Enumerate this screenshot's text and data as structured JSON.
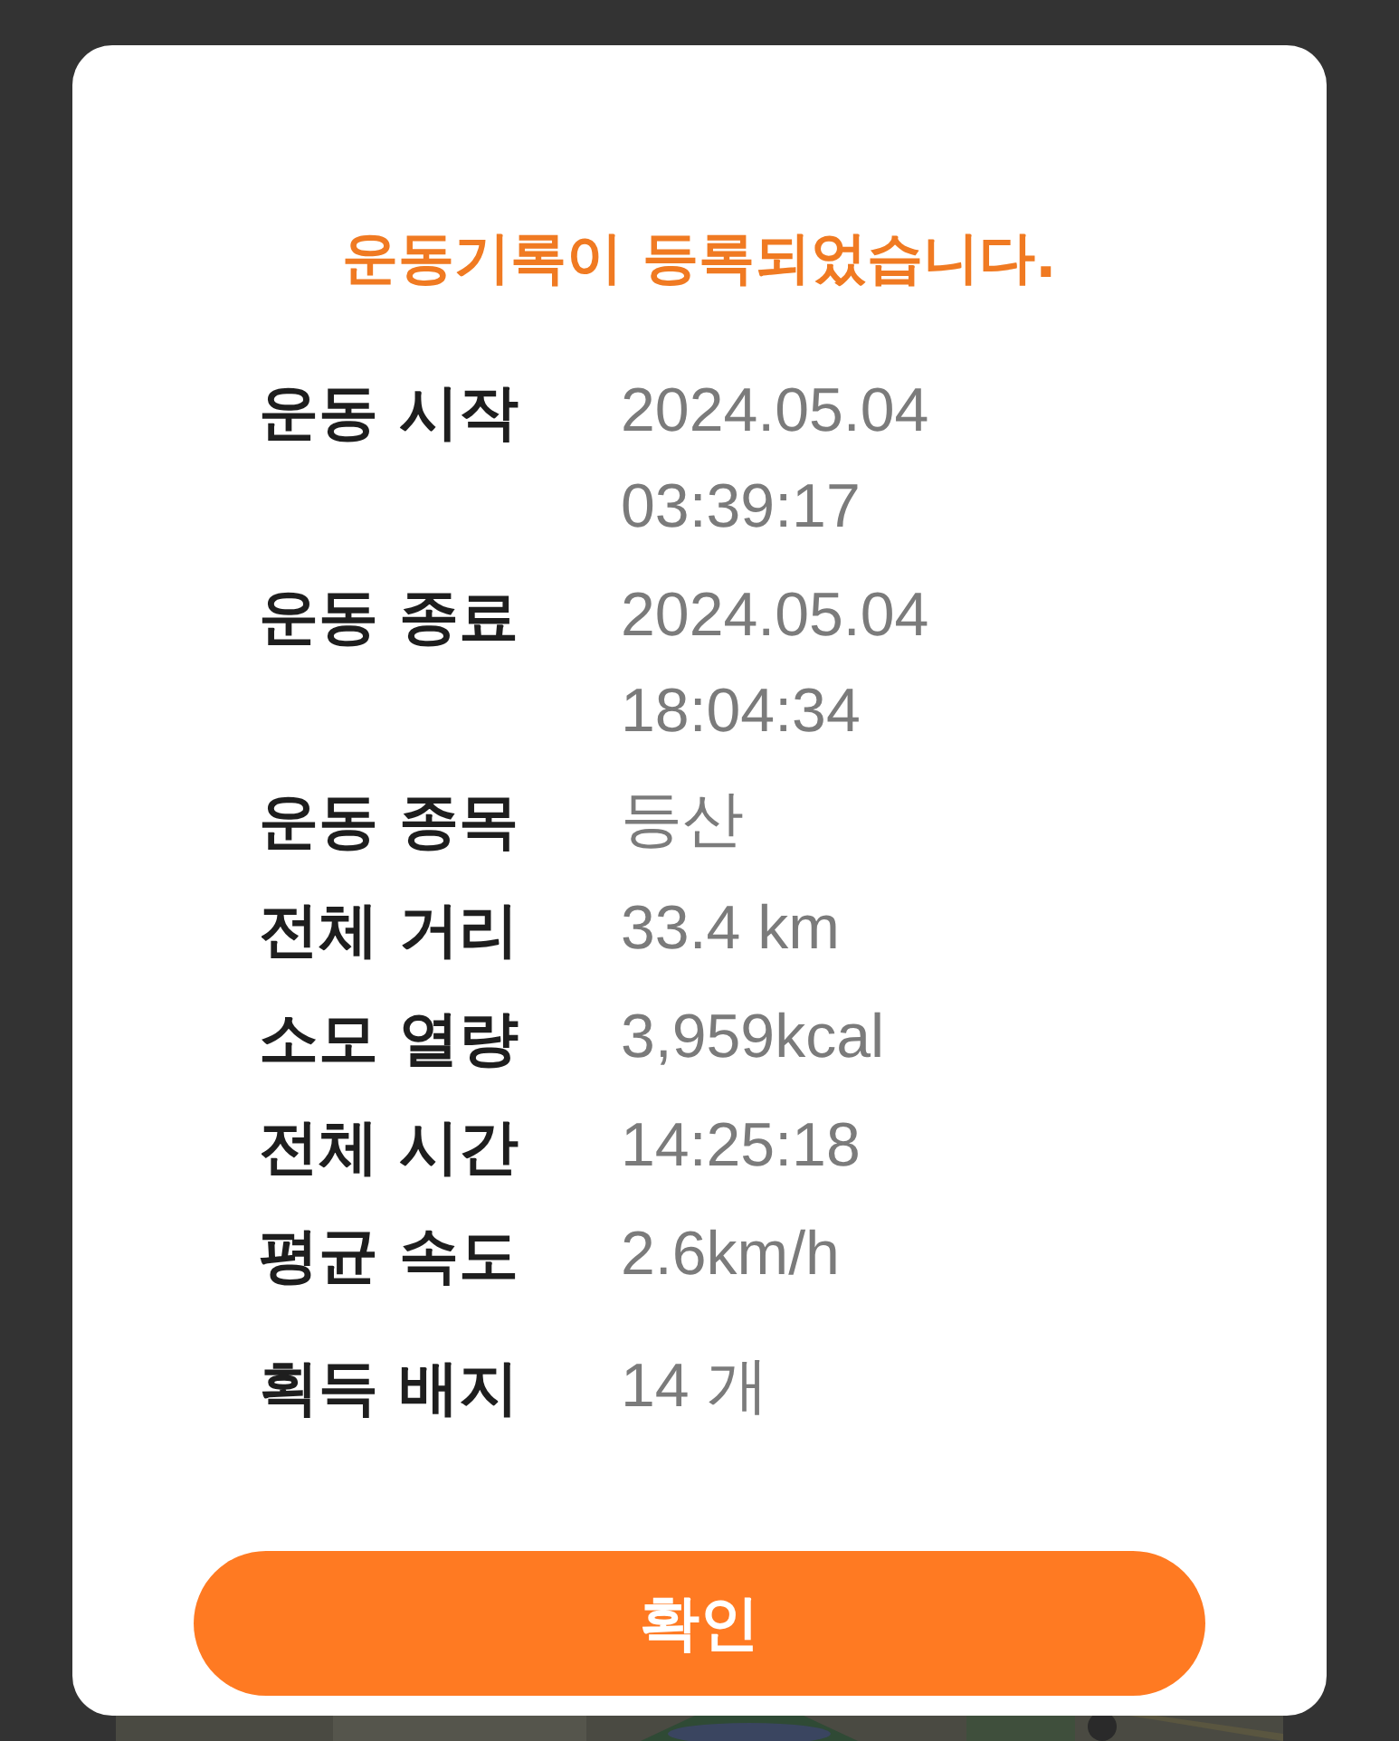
{
  "dialog": {
    "title": "운동기록이 등록되었습니다.",
    "rows": [
      {
        "label": "운동 시작",
        "value": [
          "2024.05.04",
          "03:39:17"
        ]
      },
      {
        "label": "운동 종료",
        "value": [
          "2024.05.04",
          "18:04:34"
        ]
      },
      {
        "label": "운동 종목",
        "value": [
          "등산"
        ]
      },
      {
        "label": "전체 거리",
        "value": [
          "33.4 km"
        ]
      },
      {
        "label": "소모 열량",
        "value": [
          "3,959kcal"
        ]
      },
      {
        "label": "전체 시간",
        "value": [
          "14:25:18"
        ]
      },
      {
        "label": "평균 속도",
        "value": [
          "2.6km/h"
        ]
      },
      {
        "label": "획득 배지",
        "value": [
          "14 개"
        ]
      }
    ],
    "confirm_button": "확인"
  }
}
